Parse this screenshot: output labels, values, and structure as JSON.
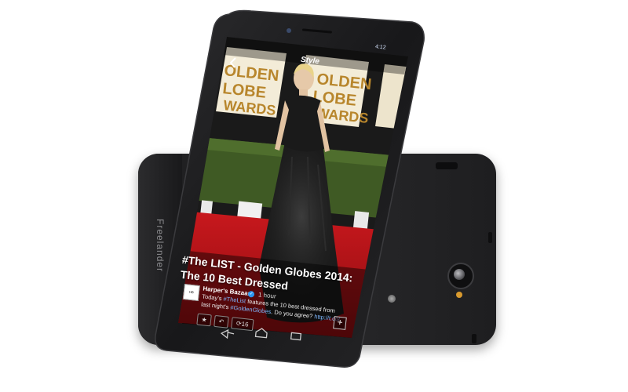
{
  "device": {
    "brand": "Freelander"
  },
  "screen": {
    "status_time": "4:12",
    "section_title": "Style",
    "backdrop_text": [
      "GOLDEN",
      "GLOBE",
      "AWARDS"
    ],
    "headline": "#The LIST - Golden Globes 2014: The 10 Best Dressed",
    "tweet": {
      "author": "Harper's Bazaar",
      "time": "1 hour",
      "body_prefix": "Today's ",
      "body_hashtag": "#TheList",
      "body_middle": " features the 10 best dressed from last night's ",
      "body_hashtag2": "#GoldenGlobes",
      "body_suffix": ". Do you agree? ",
      "body_link": "http://t.co/",
      "retweet_count": "16"
    }
  },
  "colors": {
    "body": "#1c1c1e",
    "carpet": "#c0131a",
    "hedge": "#3f5a24",
    "backdrop": "#f3ecd8",
    "gold": "#b8862c",
    "gown": "#1a1a1a",
    "flash": "#d99a2e"
  },
  "icons": [
    "back-icon",
    "home-icon",
    "recent-apps-icon",
    "star-icon",
    "reply-icon",
    "retweet-icon",
    "plus-icon",
    "camera-lens-icon"
  ]
}
